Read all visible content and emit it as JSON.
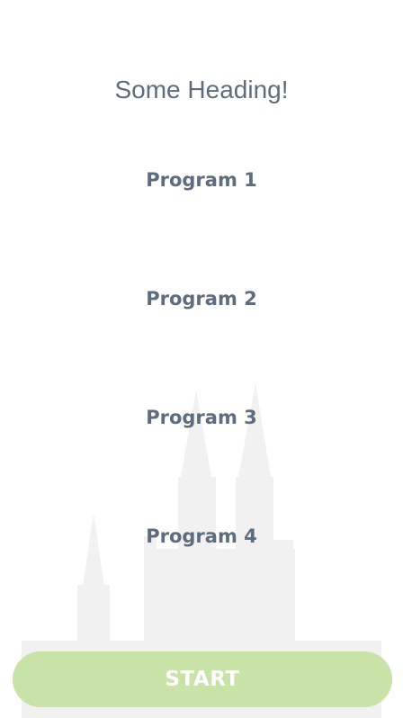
{
  "heading": "Some Heading!",
  "programs": [
    {
      "label": "Program 1"
    },
    {
      "label": "Program 2"
    },
    {
      "label": "Program 3"
    },
    {
      "label": "Program 4"
    }
  ],
  "start_button": {
    "label": "START"
  },
  "colors": {
    "text": "#5e6d7d",
    "button_bg": "#c8e2a8",
    "button_text": "#ffffff",
    "background": "#ffffff",
    "silhouette": "#f0f0f0"
  },
  "background_image": {
    "icon": "cathedral-silhouette-icon"
  }
}
